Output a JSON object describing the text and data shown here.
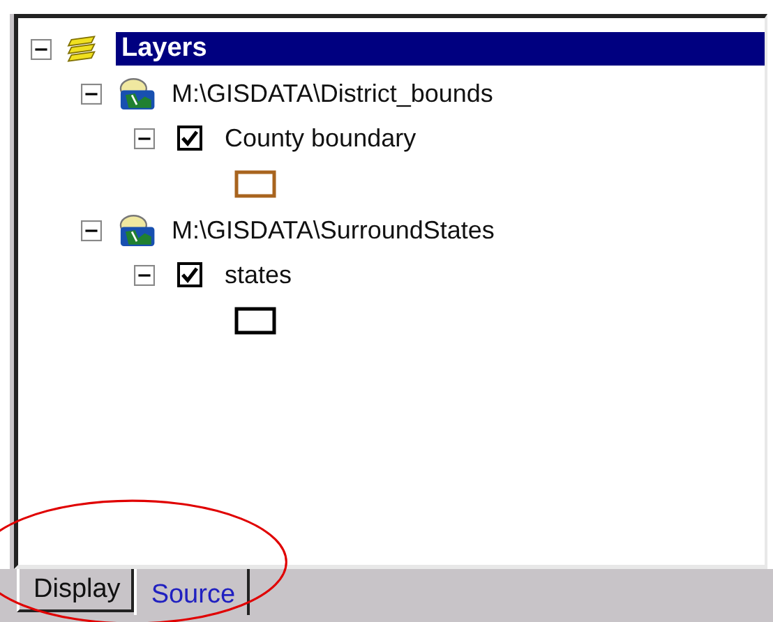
{
  "tree": {
    "label": "Layers",
    "expanded": true,
    "selected": true,
    "children": [
      {
        "label": "M:\\GISDATA\\District_bounds",
        "expanded": true,
        "children": [
          {
            "label": "County boundary",
            "expanded": true,
            "checked": true,
            "color": "#a8641e"
          }
        ]
      },
      {
        "label": "M:\\GISDATA\\SurroundStates",
        "expanded": true,
        "children": [
          {
            "label": "states",
            "expanded": true,
            "checked": true,
            "color": "#000000"
          }
        ]
      }
    ]
  },
  "tabs": [
    {
      "label": "Display",
      "selected": false
    },
    {
      "label": "Source",
      "selected": true
    }
  ]
}
